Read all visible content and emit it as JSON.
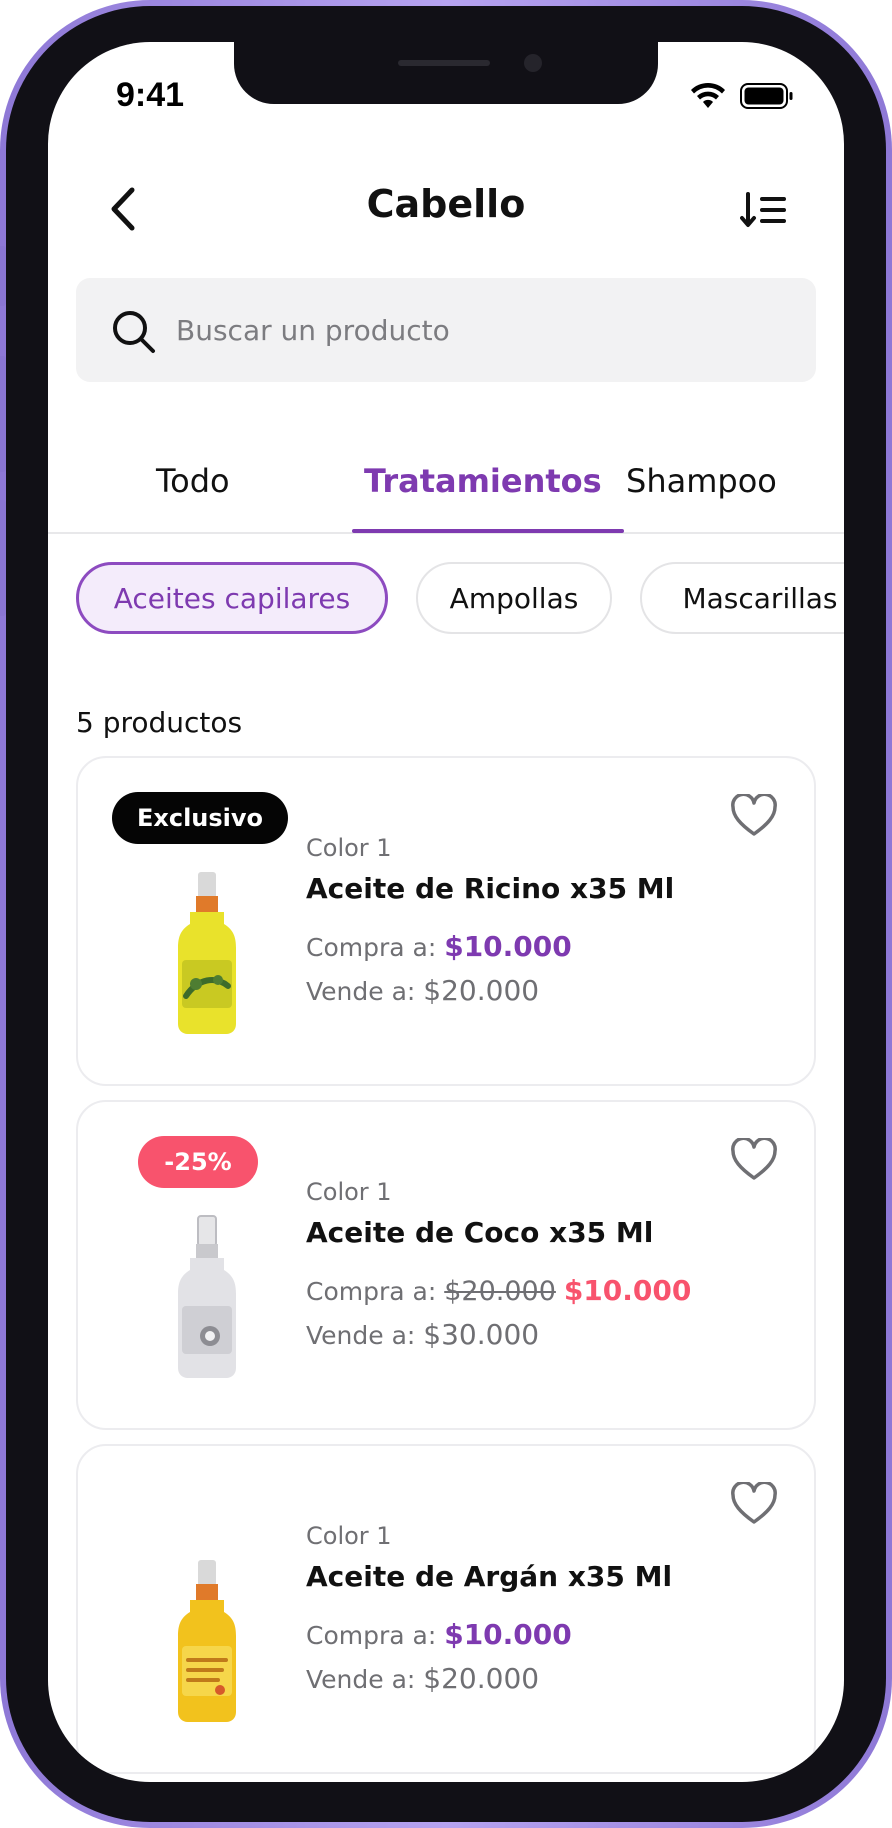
{
  "status": {
    "time": "9:41"
  },
  "header": {
    "title": "Cabello"
  },
  "search": {
    "placeholder": "Buscar un producto"
  },
  "tabs": [
    {
      "label": "Todo"
    },
    {
      "label": "Tratamientos",
      "active": true
    },
    {
      "label": "Shampoo"
    }
  ],
  "chips": [
    {
      "label": "Aceites capilares",
      "active": true
    },
    {
      "label": "Ampollas"
    },
    {
      "label": "Mascarillas"
    }
  ],
  "product_count": "5 productos",
  "products": [
    {
      "badge": "Exclusivo",
      "brand": "Color 1",
      "name": "Aceite de Ricino x35 Ml",
      "buy_label": "Compra a:",
      "buy_price": "$10.000",
      "sell_label": "Vende a:",
      "sell_price": "$20.000"
    },
    {
      "badge": "-25%",
      "brand": "Color 1",
      "name": "Aceite de Coco x35 Ml",
      "buy_label": "Compra a:",
      "old_price": "$20.000",
      "buy_price": "$10.000",
      "sell_label": "Vende a:",
      "sell_price": "$30.000"
    },
    {
      "brand": "Color 1",
      "name": "Aceite de Argán x35 Ml",
      "buy_label": "Compra a:",
      "buy_price": "$10.000",
      "sell_label": "Vende a:",
      "sell_price": "$20.000"
    }
  ],
  "colors": {
    "accent": "#7e3ab0",
    "sale": "#f8536d",
    "frame": "#8e78d6"
  },
  "icons": [
    "back-arrow-icon",
    "sort-list-icon",
    "search-icon",
    "heart-icon",
    "wifi-icon",
    "battery-icon"
  ]
}
